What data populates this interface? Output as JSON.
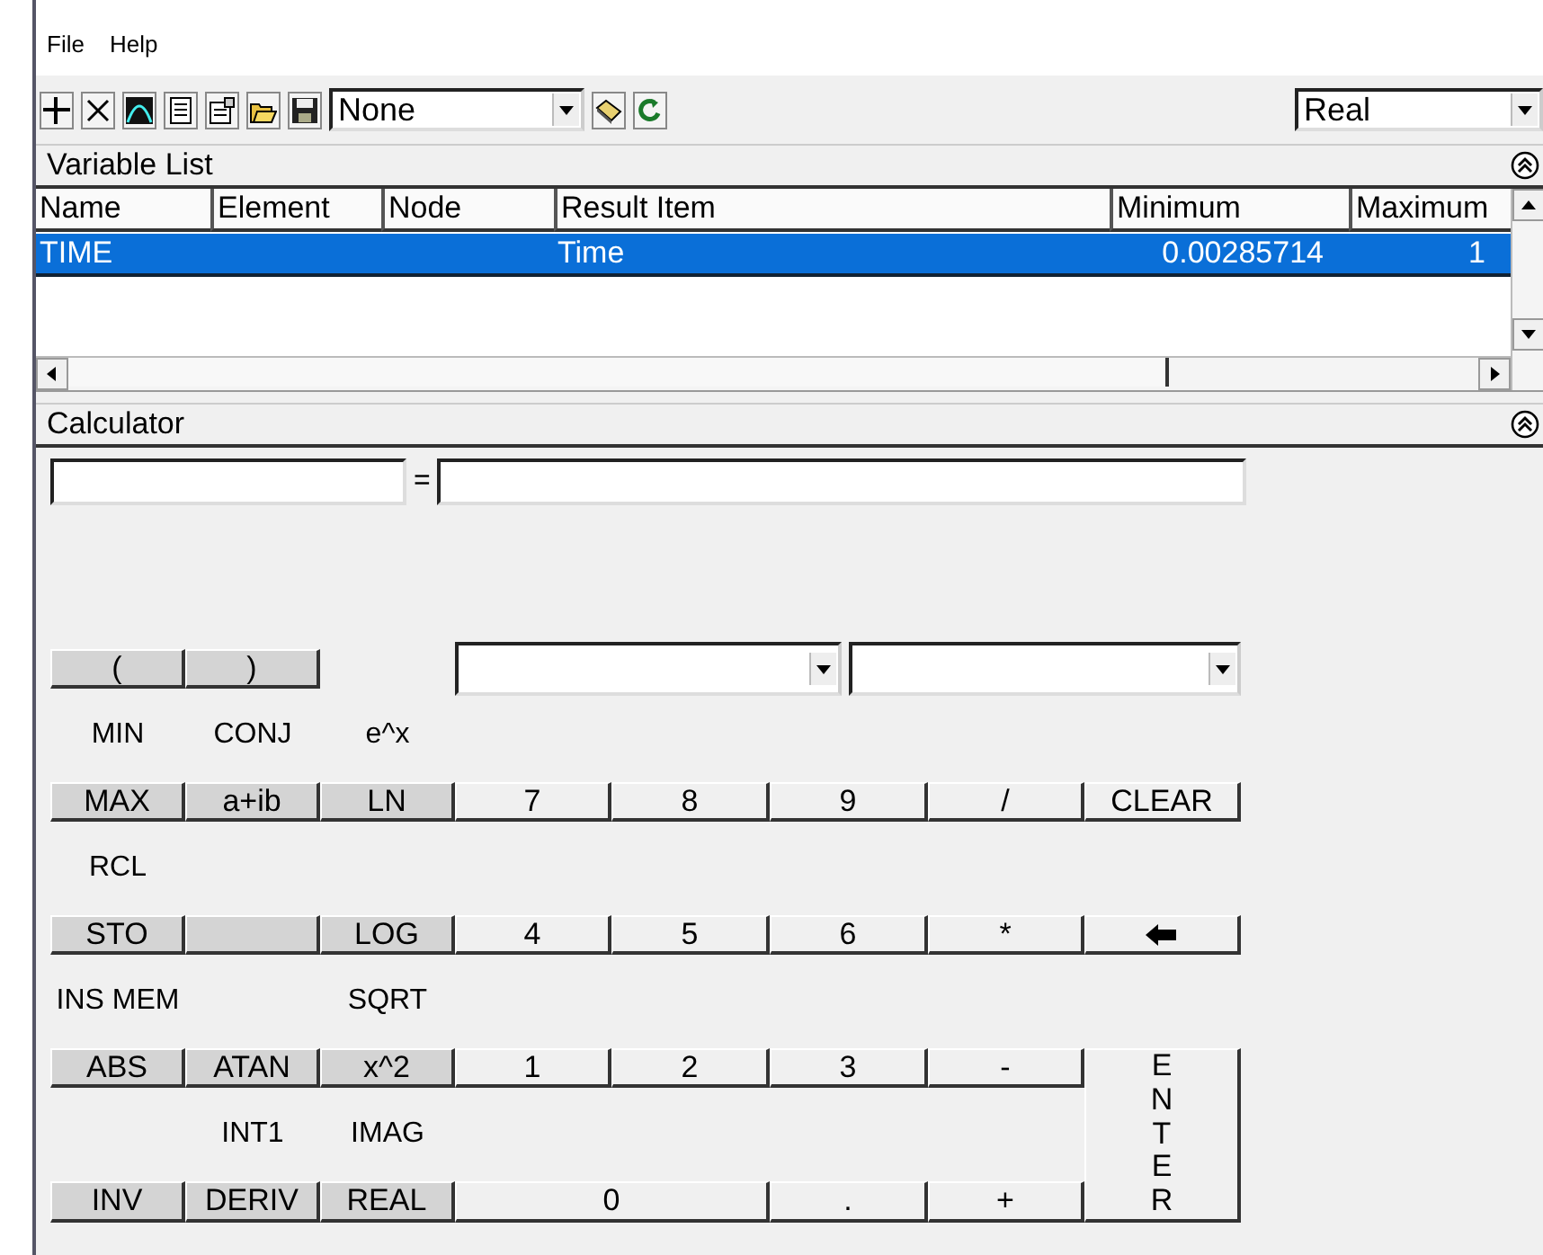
{
  "menu": [
    "File",
    "Help"
  ],
  "toolbar": {
    "filter": "None",
    "mode": "Real"
  },
  "variable_list": {
    "title": "Variable List",
    "columns": [
      "Name",
      "Element",
      "Node",
      "Result Item",
      "Minimum",
      "Maximum"
    ],
    "rows": [
      {
        "cells": [
          "TIME",
          "",
          "",
          "Time",
          "0.00285714",
          "1"
        ],
        "selected": true
      }
    ]
  },
  "calculator": {
    "title": "Calculator",
    "equals": "=",
    "rows": [
      {
        "keys": [
          {
            "kind": "function",
            "label": "("
          },
          {
            "kind": "function",
            "label": ")"
          }
        ]
      },
      {
        "keys": [
          {
            "kind": "function",
            "label": "MAX",
            "shift": "MIN"
          },
          {
            "kind": "function",
            "label": "a+ib",
            "shift": "CONJ"
          },
          {
            "kind": "function",
            "label": "LN",
            "shift": "e^x"
          },
          {
            "kind": "digit",
            "label": "7"
          },
          {
            "kind": "digit",
            "label": "8"
          },
          {
            "kind": "digit",
            "label": "9"
          },
          {
            "kind": "digit",
            "label": "/"
          },
          {
            "kind": "digit",
            "label": "CLEAR"
          }
        ]
      },
      {
        "keys": [
          {
            "kind": "function",
            "label": "STO",
            "shift": "RCL"
          },
          {
            "kind": "blank"
          },
          {
            "kind": "function",
            "label": "LOG"
          },
          {
            "kind": "digit",
            "label": "4"
          },
          {
            "kind": "digit",
            "label": "5"
          },
          {
            "kind": "digit",
            "label": "6"
          },
          {
            "kind": "digit",
            "label": "*"
          },
          {
            "kind": "backspace"
          }
        ]
      },
      {
        "keys": [
          {
            "kind": "function",
            "label": "ABS",
            "shift": "INS MEM"
          },
          {
            "kind": "function",
            "label": "ATAN"
          },
          {
            "kind": "function",
            "label": "x^2",
            "shift": "SQRT"
          },
          {
            "kind": "digit",
            "label": "1"
          },
          {
            "kind": "digit",
            "label": "2"
          },
          {
            "kind": "digit",
            "label": "3"
          },
          {
            "kind": "digit",
            "label": "-"
          },
          {
            "kind": "enter",
            "label": "ENTER"
          }
        ]
      },
      {
        "keys": [
          {
            "kind": "function",
            "label": "INV"
          },
          {
            "kind": "function",
            "label": "DERIV",
            "shift": "INT1"
          },
          {
            "kind": "function",
            "label": "REAL",
            "shift": "IMAG"
          },
          {
            "kind": "wide",
            "label": "0"
          },
          {
            "kind": "digit",
            "label": "."
          },
          {
            "kind": "digit",
            "label": "+"
          }
        ]
      }
    ]
  }
}
